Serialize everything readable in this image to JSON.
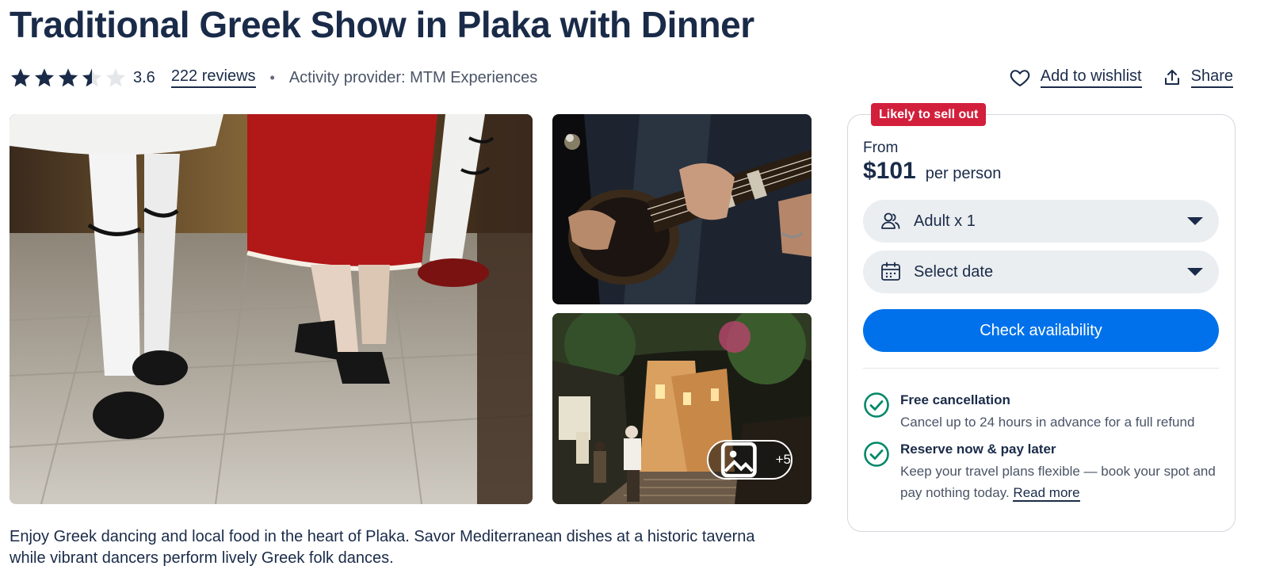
{
  "page": {
    "title": "Traditional Greek Show in Plaka with Dinner",
    "description": "Enjoy Greek dancing and local food in the heart of Plaka. Savor Mediterranean dishes at a historic taverna while vibrant dancers perform lively Greek folk dances."
  },
  "rating": {
    "value": "3.6",
    "stars_filled": 3.5,
    "stars_total": 5,
    "reviews_label": "222 reviews",
    "separator": "•",
    "provider": "Activity provider: MTM Experiences"
  },
  "actions": {
    "wishlist_label": "Add to wishlist",
    "wishlist_icon": "heart-outline-icon",
    "share_label": "Share",
    "share_icon": "share-upload-icon"
  },
  "gallery": {
    "more_count": "+5",
    "more_icon": "image-icon"
  },
  "booking": {
    "badge": "Likely to sell out",
    "from_label": "From",
    "price": "$101",
    "price_unit": "per person",
    "participants_label": "Adult x 1",
    "participants_icon": "people-icon",
    "date_label": "Select date",
    "date_icon": "calendar-icon",
    "cta_label": "Check availability",
    "perks": [
      {
        "title": "Free cancellation",
        "desc": "Cancel up to 24 hours in advance for a full refund"
      },
      {
        "title": "Reserve now & pay later",
        "desc": "Keep your travel plans flexible — book your spot and pay nothing today.",
        "link": "Read more"
      }
    ]
  },
  "colors": {
    "brand_text": "#1a2b49",
    "cta_blue": "#0071eb",
    "badge_red": "#d2203c",
    "check_green": "#008768",
    "pill_bg": "#ebeef1"
  }
}
